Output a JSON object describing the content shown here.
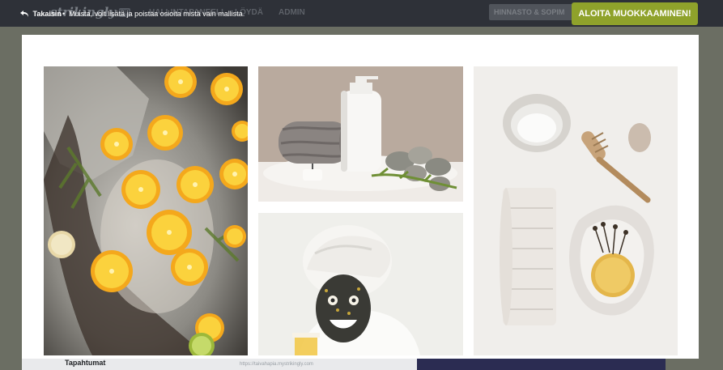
{
  "header": {
    "logo": "strikingly",
    "vip_badge": "VIP",
    "nav": [
      "HALLINTAPANEELI",
      "LÖYDÄ",
      "ADMIN"
    ],
    "pricing_label": "HINNASTO & SOPIM",
    "start_label": "ALOITA MUOKKAAMINEN!"
  },
  "overlay": {
    "back_label": "Takaisin",
    "tip": "Muista, voit lisätä ja poistaa osioita mistä vain mallista."
  },
  "gallery": {
    "images": [
      {
        "name": "orange-slices-bath-photo",
        "alt": "Woman in bath with orange slices"
      },
      {
        "name": "towel-and-lotion-photo",
        "alt": "Rolled towel, lotion bottle and spa stones"
      },
      {
        "name": "face-mask-photo",
        "alt": "Woman with face mask and towel on head"
      },
      {
        "name": "spa-flatlay-photo",
        "alt": "Towel, brush, salt and soap flatlay"
      }
    ]
  },
  "footer": {
    "tab_label": "Tapahtumat",
    "url_text": "https://taivahapia.mystrikingly.com"
  },
  "colors": {
    "accent": "#8fa22b",
    "header_bg": "#2e3138",
    "backdrop": "#6b6e63"
  }
}
